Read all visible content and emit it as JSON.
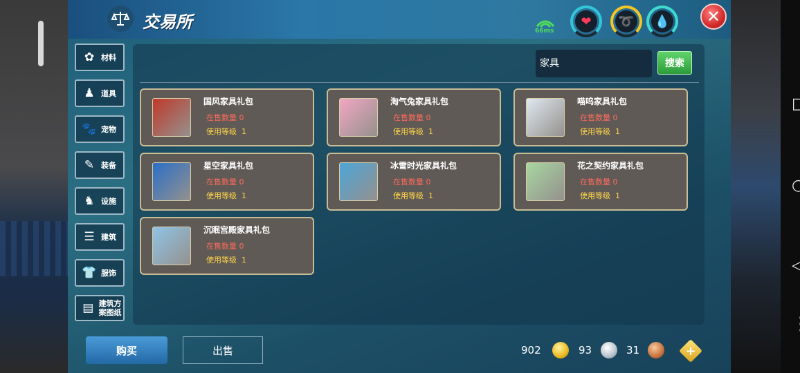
{
  "title": "交易所",
  "ping": "66ms",
  "search": {
    "value": "家具",
    "button": "搜索"
  },
  "sidebar": {
    "items": [
      {
        "label": "材料",
        "icon": "materials-icon"
      },
      {
        "label": "道具",
        "icon": "item-icon"
      },
      {
        "label": "宠物",
        "icon": "pet-paw-icon"
      },
      {
        "label": "装备",
        "icon": "equipment-icon"
      },
      {
        "label": "设施",
        "icon": "facility-icon"
      },
      {
        "label": "建筑",
        "icon": "building-icon"
      },
      {
        "label": "服饰",
        "icon": "clothing-icon"
      },
      {
        "label": "建筑方案图纸",
        "icon": "blueprint-icon"
      }
    ]
  },
  "items": [
    {
      "name": "国风家具礼包",
      "sale_label": "在售数量",
      "sale_value": "0",
      "level_label": "使用等级",
      "level_value": "1",
      "color": "#c0392b"
    },
    {
      "name": "淘气兔家具礼包",
      "sale_label": "在售数量",
      "sale_value": "0",
      "level_label": "使用等级",
      "level_value": "1",
      "color": "#f2a7c3"
    },
    {
      "name": "喵呜家具礼包",
      "sale_label": "在售数量",
      "sale_value": "0",
      "level_label": "使用等级",
      "level_value": "1",
      "color": "#dfe8f0"
    },
    {
      "name": "星空家具礼包",
      "sale_label": "在售数量",
      "sale_value": "0",
      "level_label": "使用等级",
      "level_value": "1",
      "color": "#2a6fc7"
    },
    {
      "name": "冰雪时光家具礼包",
      "sale_label": "在售数量",
      "sale_value": "0",
      "level_label": "使用等级",
      "level_value": "1",
      "color": "#4da6d9"
    },
    {
      "name": "花之契约家具礼包",
      "sale_label": "在售数量",
      "sale_value": "0",
      "level_label": "使用等级",
      "level_value": "1",
      "color": "#a8d6a0"
    },
    {
      "name": "沉眠宫殿家具礼包",
      "sale_label": "在售数量",
      "sale_value": "0",
      "level_label": "使用等级",
      "level_value": "1",
      "color": "#8fc4e6"
    }
  ],
  "tabs": {
    "buy": "购买",
    "sell": "出售"
  },
  "currency": {
    "gold": "902",
    "silver": "93",
    "bronze": "31"
  }
}
